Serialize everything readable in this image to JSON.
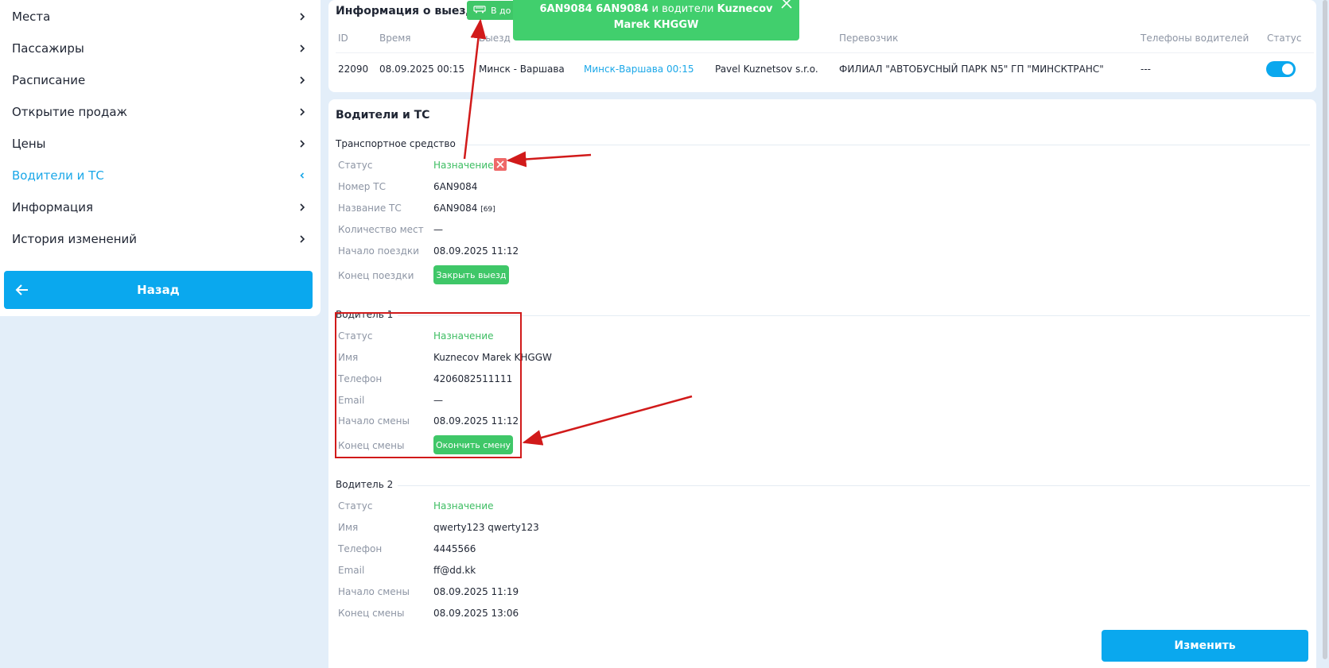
{
  "sidebar": {
    "items": [
      {
        "label": "Места"
      },
      {
        "label": "Пассажиры"
      },
      {
        "label": "Расписание"
      },
      {
        "label": "Открытие продаж"
      },
      {
        "label": "Цены"
      },
      {
        "label": "Водители и ТС"
      },
      {
        "label": "Информация"
      },
      {
        "label": "История изменений"
      }
    ],
    "back_label": "Назад"
  },
  "exit_info": {
    "title": "Информация о выезде",
    "exit_button_label": "В до",
    "columns": [
      "ID",
      "Время",
      "Выезд",
      "",
      "Перевозчик",
      "Телефоны водителей",
      "Статус"
    ],
    "row": {
      "id": "22090",
      "time": "08.09.2025 00:15",
      "exit": "Минск - Варшава",
      "route_link": "Минск-Варшава 00:15",
      "company": "Pavel Kuznetsov s.r.o.",
      "carrier": "ФИЛИАЛ \"АВТОБУСНЫЙ ПАРК N5\" ГП \"МИНСКТРАНС\"",
      "phones": "---"
    }
  },
  "toast": {
    "part1": "6AN9084 6AN9084",
    "part2": " и водители ",
    "part3": "Kuznecov Marek KHGGW"
  },
  "drivers": {
    "title": "Водители и ТС",
    "vehicle": {
      "section": "Транспортное средство",
      "labels": [
        "Статус",
        "Номер ТС",
        "Название ТС",
        "Количество мест",
        "Начало поездки",
        "Конец поездки"
      ],
      "status": "Назначение",
      "number": "6AN9084",
      "name": "6AN9084",
      "name_badge": "[69]",
      "seats": "—",
      "start": "08.09.2025 11:12",
      "close_button": "Закрыть выезд"
    },
    "driver1": {
      "section": "Водитель 1",
      "labels": [
        "Статус",
        "Имя",
        "Телефон",
        "Email",
        "Начало смены",
        "Конец смены"
      ],
      "status": "Назначение",
      "name": "Kuznecov Marek KHGGW",
      "phone": "4206082511111",
      "email": "—",
      "start": "08.09.2025 11:12",
      "end_button": "Окончить смену"
    },
    "driver2": {
      "section": "Водитель 2",
      "labels": [
        "Статус",
        "Имя",
        "Телефон",
        "Email",
        "Начало смены",
        "Конец смены"
      ],
      "status": "Назначение",
      "name": "qwerty123 qwerty123",
      "phone": "4445566",
      "email": "ff@dd.kk",
      "start": "08.09.2025 11:19",
      "end": "08.09.2025 13:06"
    },
    "edit_button": "Изменить"
  },
  "colors": {
    "accent": "#0aa8ee",
    "success": "#3fc768",
    "annotation": "#d11a1a"
  }
}
